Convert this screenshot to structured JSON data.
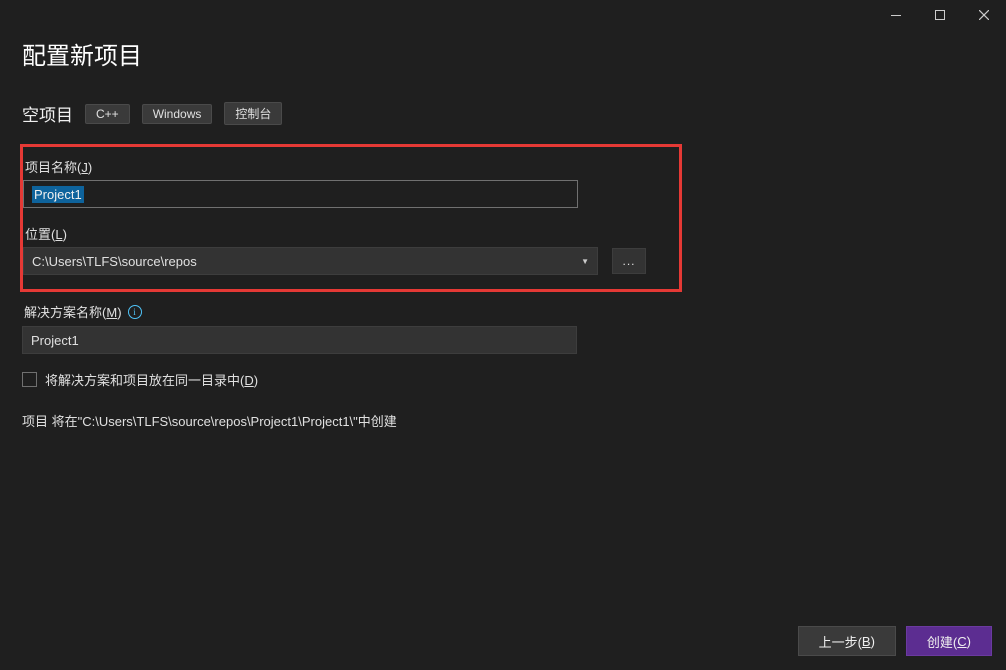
{
  "window": {
    "title": "配置新项目"
  },
  "project_type": {
    "name": "空项目",
    "tags": [
      "C++",
      "Windows",
      "控制台"
    ]
  },
  "fields": {
    "project_name": {
      "label_text": "项目名称(",
      "label_key": "J",
      "label_close": ")",
      "value": "Project1"
    },
    "location": {
      "label_text": "位置(",
      "label_key": "L",
      "label_close": ")",
      "value": "C:\\Users\\TLFS\\source\\repos",
      "browse": "..."
    },
    "solution_name": {
      "label_text": "解决方案名称(",
      "label_key": "M",
      "label_close": ")",
      "value": "Project1"
    }
  },
  "checkbox": {
    "label_text": "将解决方案和项目放在同一目录中(",
    "label_key": "D",
    "label_close": ")"
  },
  "path_preview": "项目 将在\"C:\\Users\\TLFS\\source\\repos\\Project1\\Project1\\\"中创建",
  "buttons": {
    "back_text": "上一步(",
    "back_key": "B",
    "back_close": ")",
    "create_text": "创建(",
    "create_key": "C",
    "create_close": ")"
  }
}
